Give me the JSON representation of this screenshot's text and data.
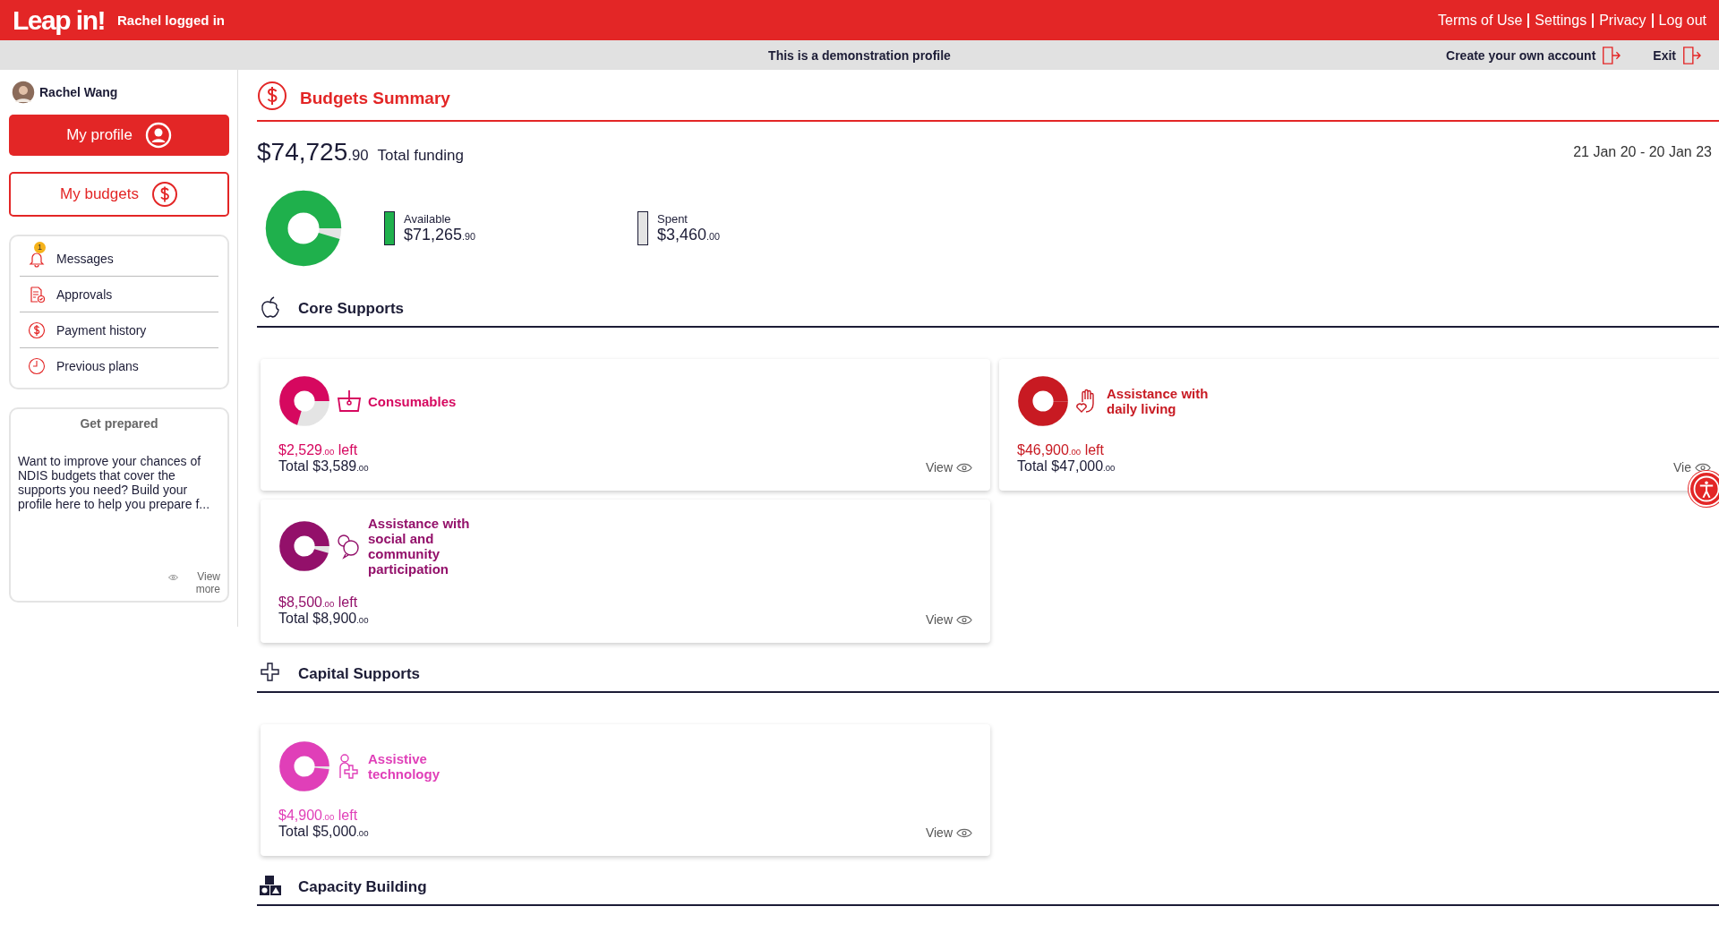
{
  "header": {
    "logo": "Leap in!",
    "user_status": "Rachel logged in",
    "links": [
      "Terms of Use",
      "Settings",
      "Privacy",
      "Log out"
    ]
  },
  "demo_bar": {
    "message": "This is a demonstration profile",
    "create_account": "Create your own account",
    "exit": "Exit"
  },
  "sidebar": {
    "user_name": "Rachel Wang",
    "profile_button": "My profile",
    "budgets_button": "My budgets",
    "menu": [
      {
        "kind": "messages",
        "label": "Messages",
        "badge": "1"
      },
      {
        "kind": "approvals",
        "label": "Approvals"
      },
      {
        "kind": "payments",
        "label": "Payment history"
      },
      {
        "kind": "plans",
        "label": "Previous plans"
      }
    ],
    "prepared": {
      "title": "Get prepared",
      "text": "Want to improve your chances of NDIS budgets that cover the supports you need? Build your profile here to help you prepare f...",
      "view_more": "View more"
    }
  },
  "summary": {
    "title": "Budgets Summary",
    "total": "$74,725",
    "total_cents": ".90",
    "total_label": "Total funding",
    "period": "21 Jan 20 - 20 Jan 23",
    "level": 0.954,
    "legend": [
      {
        "label": "Available",
        "amount": "$71,265",
        "cents": ".90",
        "color": "#1fb04c"
      },
      {
        "label": "Spent",
        "amount": "$3,460",
        "cents": ".00",
        "color": "#e4e4e4"
      }
    ]
  },
  "sections": [
    {
      "kind": "core",
      "title": "Core Supports",
      "cards": [
        {
          "kind": "consumables",
          "title": "Consumables",
          "color": "#d6085f",
          "level": 0.705,
          "left": "$2,529",
          "left_cents": ".00",
          "left_label": "left",
          "total_label": "Total",
          "total": "$3,589",
          "total_cents": ".00",
          "view": "View"
        },
        {
          "kind": "daily",
          "title": "Assistance with daily living",
          "color": "#c81a22",
          "level": 0.998,
          "left": "$46,900",
          "left_cents": ".00",
          "left_label": "left",
          "total_label": "Total",
          "total": "$47,000",
          "total_cents": ".00",
          "view": "Vie"
        },
        {
          "kind": "social",
          "title": "Assistance with social and community participation",
          "color": "#93106a",
          "level": 0.955,
          "left": "$8,500",
          "left_cents": ".00",
          "left_label": "left",
          "total_label": "Total",
          "total": "$8,900",
          "total_cents": ".00",
          "view": "View"
        }
      ]
    },
    {
      "kind": "capital",
      "title": "Capital Supports",
      "cards": [
        {
          "kind": "assistive",
          "title": "Assistive technology",
          "color": "#e03fb8",
          "level": 0.98,
          "left": "$4,900",
          "left_cents": ".00",
          "left_label": "left",
          "total_label": "Total",
          "total": "$5,000",
          "total_cents": ".00",
          "view": "View"
        }
      ]
    },
    {
      "kind": "capacity",
      "title": "Capacity Building"
    }
  ]
}
